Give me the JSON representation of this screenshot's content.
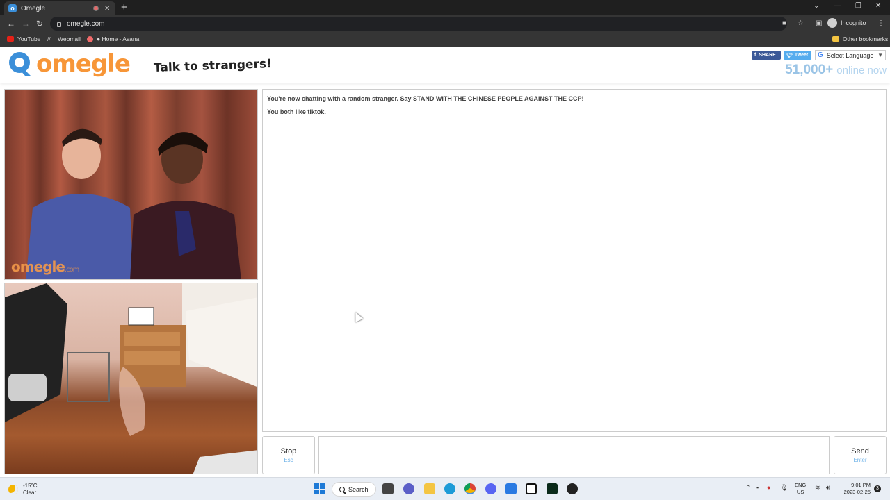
{
  "browser": {
    "tab_title": "Omegle",
    "url": "omegle.com",
    "profile_label": "Incognito",
    "bookmarks": [
      "YouTube",
      "Webmail",
      "● Home - Asana"
    ],
    "other_bookmarks": "Other bookmarks"
  },
  "site": {
    "logo_text": "omegle",
    "tagline": "Talk to strangers!",
    "share_label": "SHARE",
    "tweet_label": "Tweet",
    "language_label": "Select Language",
    "online_count": "51,000+",
    "online_label": "online now",
    "watermark": "omegle",
    "watermark_suffix": ".com"
  },
  "chat": {
    "messages": [
      "You're now chatting with a random stranger. Say STAND WITH THE CHINESE PEOPLE AGAINST THE CCP!",
      "You both like tiktok."
    ],
    "stop_label": "Stop",
    "stop_key": "Esc",
    "send_label": "Send",
    "send_key": "Enter",
    "message_value": ""
  },
  "taskbar": {
    "temperature": "-15°C",
    "condition": "Clear",
    "search_label": "Search",
    "lang_code": "ENG",
    "region": "US",
    "time": "9:01 PM",
    "date": "2023-02-25",
    "notification_count": "3"
  },
  "colors": {
    "brand_orange": "#f79638",
    "brand_blue": "#3b8fd9",
    "online_blue": "#9ac4e6"
  }
}
